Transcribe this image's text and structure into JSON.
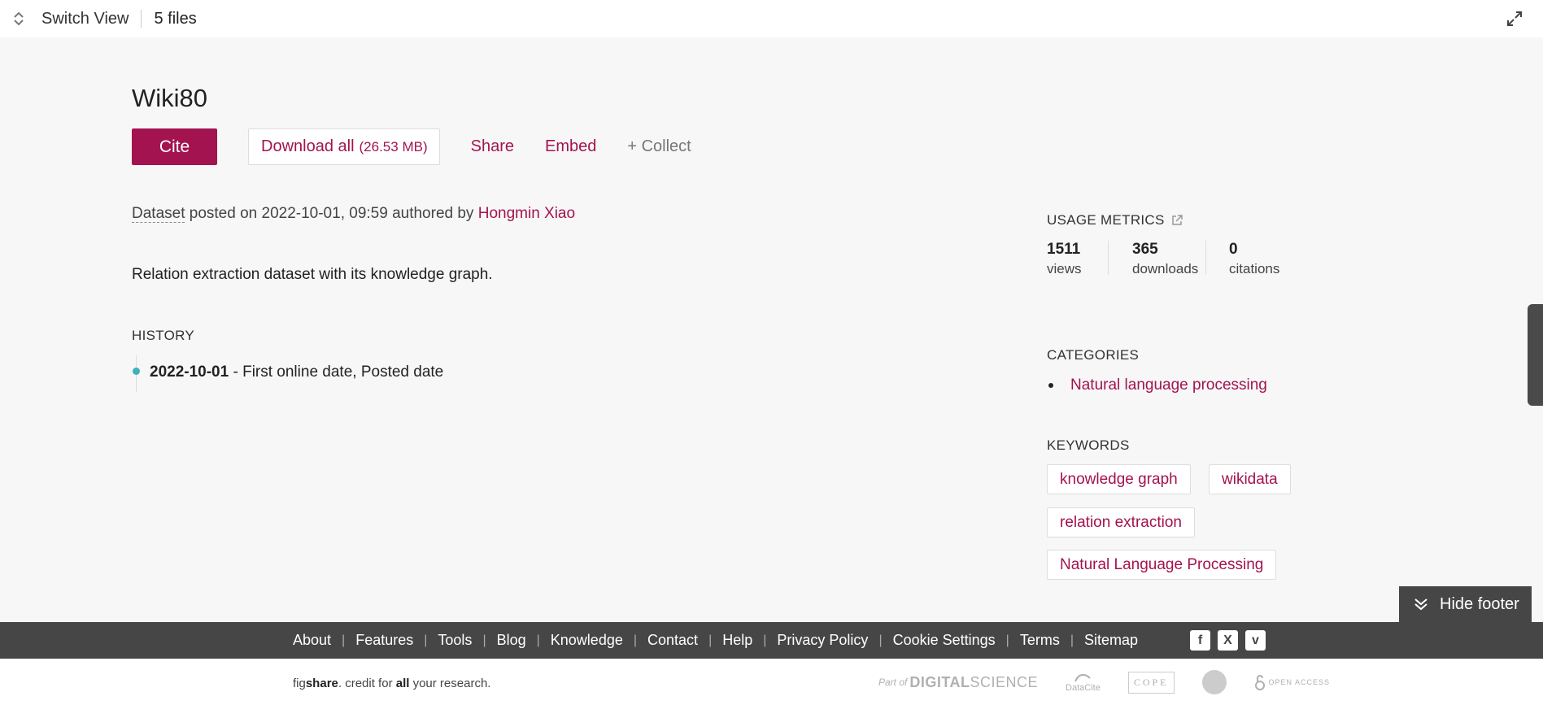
{
  "topbar": {
    "switch_view": "Switch View",
    "files": "5 files"
  },
  "item": {
    "title": "Wiki80",
    "cite": "Cite",
    "download": "Download all",
    "download_size": "(26.53 MB)",
    "share": "Share",
    "embed": "Embed",
    "collect": "+ Collect",
    "type": "Dataset",
    "posted_on": "posted on 2022-10-01, 09:59 authored by",
    "author": "Hongmin Xiao",
    "description": "Relation extraction dataset with its knowledge graph."
  },
  "history": {
    "heading": "HISTORY",
    "entries": [
      {
        "date": "2022-10-01",
        "text": "- First online date, Posted date"
      }
    ]
  },
  "metrics": {
    "heading": "USAGE METRICS",
    "items": [
      {
        "value": "1511",
        "label": "views"
      },
      {
        "value": "365",
        "label": "downloads"
      },
      {
        "value": "0",
        "label": "citations"
      }
    ]
  },
  "categories": {
    "heading": "CATEGORIES",
    "items": [
      "Natural language processing"
    ]
  },
  "keywords": {
    "heading": "KEYWORDS",
    "items": [
      "knowledge graph",
      "wikidata",
      "relation extraction",
      "Natural Language Processing"
    ]
  },
  "hide_footer": "Hide footer",
  "footer": {
    "links": [
      "About",
      "Features",
      "Tools",
      "Blog",
      "Knowledge",
      "Contact",
      "Help",
      "Privacy Policy",
      "Cookie Settings",
      "Terms",
      "Sitemap"
    ],
    "socials": [
      "facebook-icon",
      "x-icon",
      "vimeo-icon"
    ],
    "credit_pre": "fig",
    "credit_brand": "share",
    "credit_mid": ". credit for ",
    "credit_all": "all",
    "credit_post": " your research.",
    "partners": {
      "ds_prefix": "Part of",
      "ds_name": "DIGITAL",
      "ds_suffix": "SCIENCE",
      "datacite": "DataCite",
      "cope": "COPE",
      "open_access": "OPEN ACCESS"
    }
  },
  "colors": {
    "accent": "#a3134f",
    "footer_bg": "#464646",
    "history_dot": "#3fb1b8"
  }
}
